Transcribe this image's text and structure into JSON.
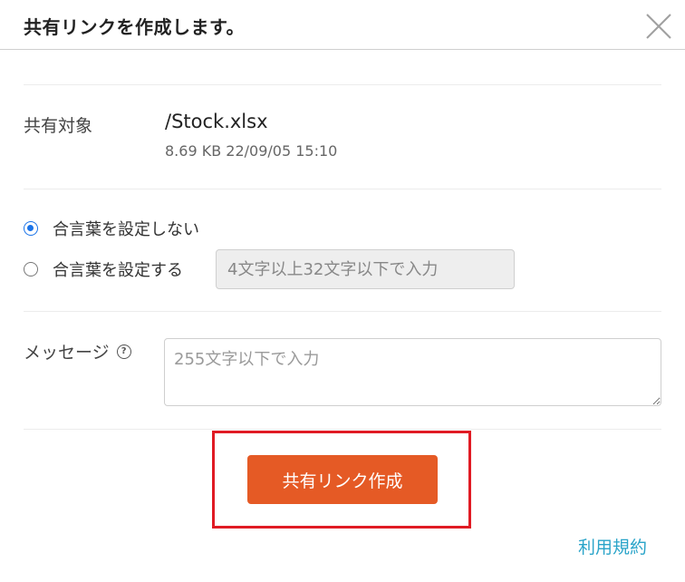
{
  "dialog": {
    "title": "共有リンクを作成します。",
    "close_icon": "close-x-icon"
  },
  "share_target": {
    "label": "共有対象",
    "file_name": "/Stock.xlsx",
    "file_meta": "8.69 KB 22/09/05 15:10"
  },
  "password": {
    "option_none": "合言葉を設定しない",
    "option_set": "合言葉を設定する",
    "selected": "none",
    "placeholder": "4文字以上32文字以下で入力",
    "value": ""
  },
  "message": {
    "label": "メッセージ",
    "help_icon": "question-circle-icon",
    "placeholder": "255文字以下で入力",
    "value": ""
  },
  "actions": {
    "create_label": "共有リンク作成",
    "create_color": "#e55a25",
    "highlight_color": "#e01b24"
  },
  "footer": {
    "terms_label": "利用規約",
    "link_color": "#2aa4c9"
  }
}
